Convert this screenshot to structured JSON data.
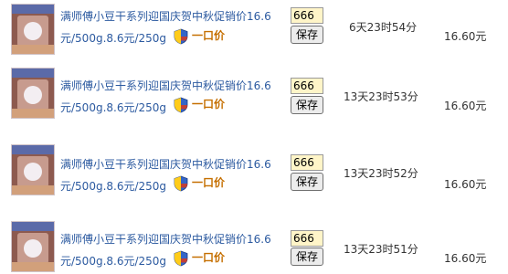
{
  "items": [
    {
      "title_line1": "满师傅小豆干系列迎国庆贺中秋促销价16.6",
      "title_line2": "元/500g.8.6元/250g",
      "buy_label": "一口价",
      "quantity": "666",
      "save_label": "保存",
      "time_left": "6天23时54分",
      "price": "16.60元"
    },
    {
      "title_line1": "满师傅小豆干系列迎国庆贺中秋促销价16.6",
      "title_line2": "元/500g.8.6元/250g",
      "buy_label": "一口价",
      "quantity": "666",
      "save_label": "保存",
      "time_left": "13天23时53分",
      "price": "16.60元"
    },
    {
      "title_line1": "满师傅小豆干系列迎国庆贺中秋促销价16.6",
      "title_line2": "元/500g.8.6元/250g",
      "buy_label": "一口价",
      "quantity": "666",
      "save_label": "保存",
      "time_left": "13天23时52分",
      "price": "16.60元"
    },
    {
      "title_line1": "满师傅小豆干系列迎国庆贺中秋促销价16.6",
      "title_line2": "元/500g.8.6元/250g",
      "buy_label": "一口价",
      "quantity": "666",
      "save_label": "保存",
      "time_left": "13天23时51分",
      "price": "16.60元"
    }
  ],
  "colors": {
    "title": "#2c5aa0",
    "buy_label": "#c56f00",
    "quantity_bg": "#fff5c8"
  },
  "icons": {
    "thumbnail": "product-image",
    "badge": "shield-icon"
  }
}
